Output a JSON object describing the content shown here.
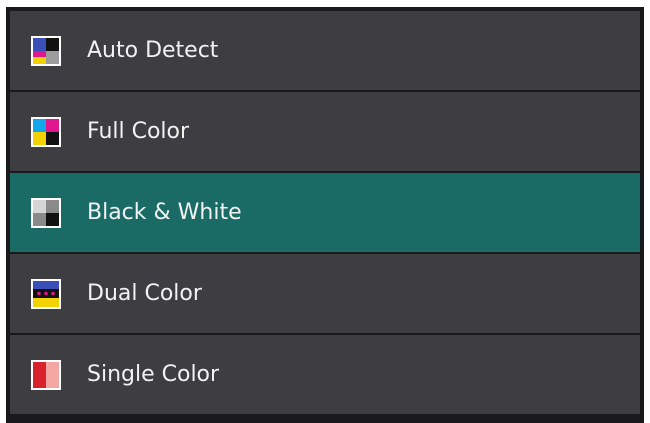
{
  "color_mode_list": {
    "selected_index": 2,
    "items": [
      {
        "label": "Auto Detect",
        "icon": "auto-detect-icon"
      },
      {
        "label": "Full Color",
        "icon": "full-color-icon"
      },
      {
        "label": "Black & White",
        "icon": "black-white-icon"
      },
      {
        "label": "Dual Color",
        "icon": "dual-color-icon"
      },
      {
        "label": "Single Color",
        "icon": "single-color-icon"
      }
    ]
  },
  "colors": {
    "item_background": "#3d3d42",
    "selected_background": "#1a6a66",
    "text": "#f2f2f2"
  }
}
